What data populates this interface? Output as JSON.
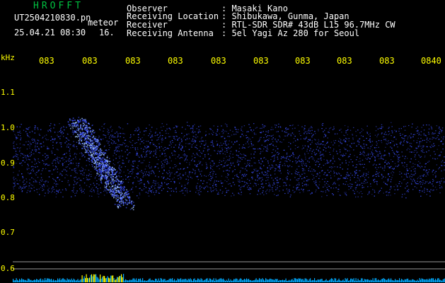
{
  "header": {
    "app_title": "HROFFT",
    "filename": "UT2504210830.pn",
    "annotation": "meteor",
    "datetime": "25.04.21 08:30",
    "count": "16."
  },
  "metadata": [
    {
      "label": "Observer",
      "value": ": Masaki Kano"
    },
    {
      "label": "Receiving Location",
      "value": ": Shibukawa, Gunma, Japan"
    },
    {
      "label": "Receiver",
      "value": ": RTL-SDR SDR# 43dB L15 96.7MHz CW"
    },
    {
      "label": "Receiving Antenna",
      "value": ": 5el Yagi Az 280 for Seoul"
    }
  ],
  "axis": {
    "unit_label": "kHz",
    "time_ticks": [
      "083",
      "083",
      "083",
      "083",
      "083",
      "083",
      "083",
      "083",
      "083",
      "0840"
    ],
    "freq_ticks": [
      "1.1",
      "1.0",
      "0.9",
      "0.8",
      "0.7",
      "0.6"
    ]
  },
  "colors": {
    "background": "#000000",
    "title": "#00c040",
    "header_text": "#ffffff",
    "tick_text": "#ffff00",
    "freq_text": "#ffff00",
    "signal": "#3c50ff",
    "meteor": "#9fc4ff",
    "baseline": "#00aaff",
    "baseline_peak": "#ffff00",
    "guide_line": "#cccccc"
  }
}
